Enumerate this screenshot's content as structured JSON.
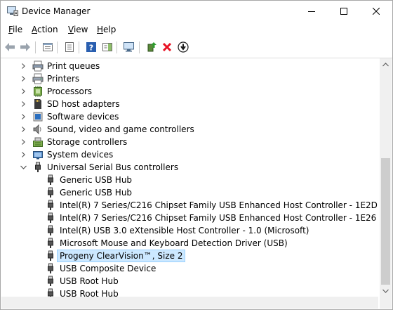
{
  "window": {
    "title": "Device Manager"
  },
  "menu": [
    {
      "label": "File",
      "key": "F"
    },
    {
      "label": "Action",
      "key": "A"
    },
    {
      "label": "View",
      "key": "V"
    },
    {
      "label": "Help",
      "key": "H"
    }
  ],
  "toolbar": {
    "icons": [
      "back-icon",
      "forward-icon",
      "properties-icon",
      "console-tree-icon",
      "help-icon",
      "action-pane-icon",
      "scan-hardware-icon",
      "update-driver-icon",
      "uninstall-icon",
      "disable-icon"
    ]
  },
  "tree": {
    "categories": [
      {
        "label": "Print queues",
        "icon": "print-queue-icon",
        "expanded": false
      },
      {
        "label": "Printers",
        "icon": "printer-icon",
        "expanded": false
      },
      {
        "label": "Processors",
        "icon": "processor-icon",
        "expanded": false
      },
      {
        "label": "SD host adapters",
        "icon": "sd-card-icon",
        "expanded": false
      },
      {
        "label": "Software devices",
        "icon": "software-device-icon",
        "expanded": false
      },
      {
        "label": "Sound, video and game controllers",
        "icon": "speaker-icon",
        "expanded": false
      },
      {
        "label": "Storage controllers",
        "icon": "storage-controller-icon",
        "expanded": false
      },
      {
        "label": "System devices",
        "icon": "system-device-icon",
        "expanded": false
      },
      {
        "label": "Universal Serial Bus controllers",
        "icon": "usb-icon",
        "expanded": true
      }
    ],
    "usb_children": [
      {
        "label": "Generic USB Hub"
      },
      {
        "label": "Generic USB Hub"
      },
      {
        "label": "Intel(R) 7 Series/C216 Chipset Family USB Enhanced Host Controller - 1E2D"
      },
      {
        "label": "Intel(R) 7 Series/C216 Chipset Family USB Enhanced Host Controller - 1E26"
      },
      {
        "label": "Intel(R) USB 3.0 eXtensible Host Controller - 1.0 (Microsoft)"
      },
      {
        "label": "Microsoft Mouse and Keyboard Detection Driver (USB)"
      },
      {
        "label": "Progeny ClearVision™, Size 2",
        "selected": true
      },
      {
        "label": "USB Composite Device"
      },
      {
        "label": "USB Root Hub"
      },
      {
        "label": "USB Root Hub"
      }
    ]
  },
  "colors": {
    "selection_bg": "#cce8ff",
    "selection_border": "#99d1ff",
    "uninstall_red": "#e81123",
    "help_blue": "#2a5fb0"
  }
}
